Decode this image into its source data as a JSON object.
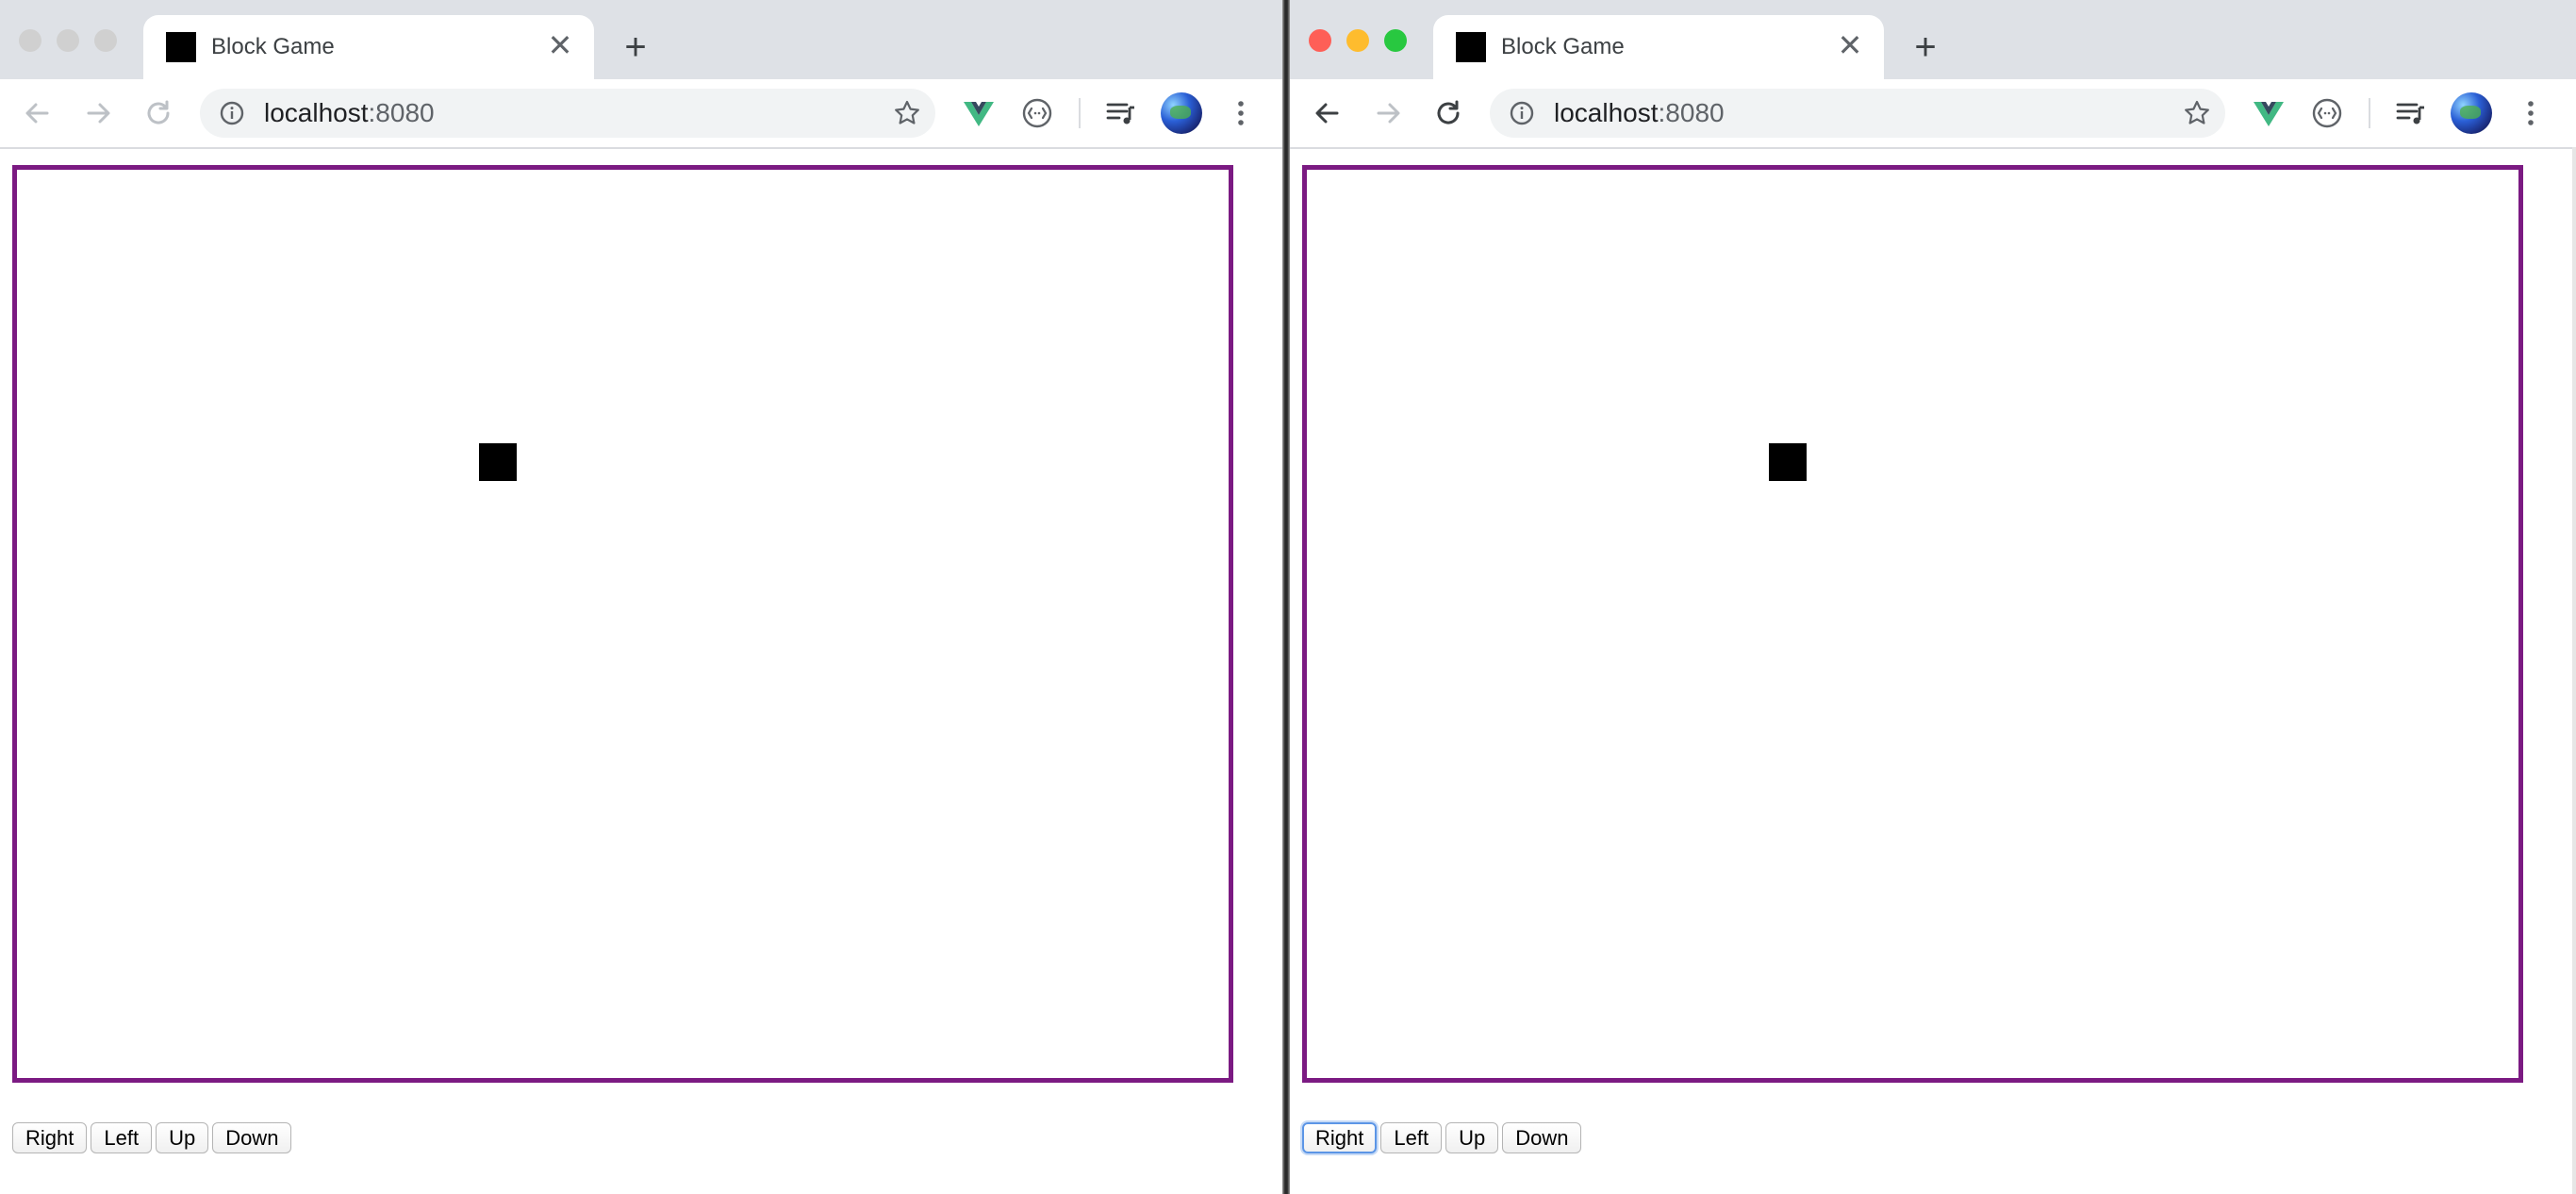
{
  "windows": [
    {
      "id": "left",
      "active": false,
      "traffic_lights": {
        "close": "#cfcfcf",
        "minimize": "#cfcfcf",
        "maximize": "#cfcfcf"
      },
      "tab": {
        "title": "Block Game",
        "close_glyph": "✕"
      },
      "new_tab_glyph": "+",
      "address": {
        "host": "localhost",
        "port": ":8080"
      },
      "game": {
        "border_color": "#7b1a82",
        "block_color": "#000000"
      },
      "controls": [
        "Right",
        "Left",
        "Up",
        "Down"
      ]
    },
    {
      "id": "right",
      "active": true,
      "traffic_lights": {
        "close": "#fe5f57",
        "minimize": "#febc2e",
        "maximize": "#28c840"
      },
      "tab": {
        "title": "Block Game",
        "close_glyph": "✕"
      },
      "new_tab_glyph": "+",
      "address": {
        "host": "localhost",
        "port": ":8080"
      },
      "game": {
        "border_color": "#7b1a82",
        "block_color": "#000000"
      },
      "controls": [
        "Right",
        "Left",
        "Up",
        "Down"
      ],
      "focused_control": "Right"
    }
  ],
  "icons": {
    "back": "arrow-left-icon",
    "forward": "arrow-right-icon",
    "reload": "reload-icon",
    "info": "info-icon",
    "bookmark": "star-icon",
    "vue_devtools": "vue-icon",
    "extension": "extension-icon",
    "media": "media-queue-icon",
    "menu": "kebab-menu-icon"
  }
}
